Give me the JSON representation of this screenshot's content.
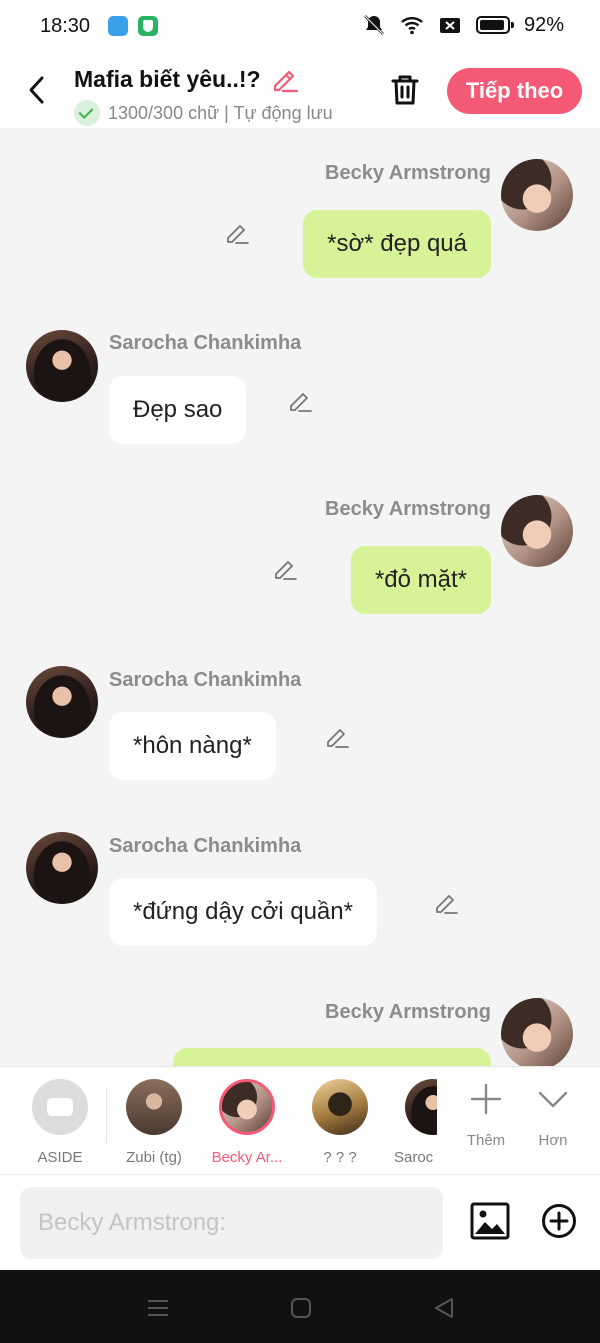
{
  "status_bar": {
    "time": "18:30",
    "battery": "92%"
  },
  "header": {
    "title": "Mafia biết yêu..!?",
    "meta": "1300/300 chữ | Tự động lưu",
    "next_label": "Tiếp theo"
  },
  "messages": [
    {
      "sender": "Becky Armstrong",
      "text": "*sờ* đẹp quá",
      "side": "right"
    },
    {
      "sender": "Sarocha Chankimha",
      "text": "Đẹp sao",
      "side": "left"
    },
    {
      "sender": "Becky Armstrong",
      "text": "*đỏ mặt*",
      "side": "right"
    },
    {
      "sender": "Sarocha Chankimha",
      "text": "*hôn nàng*",
      "side": "left"
    },
    {
      "sender": "Sarocha Chankimha",
      "text": "*đứng dậy cởi quần*",
      "side": "left"
    },
    {
      "sender": "Becky Armstrong",
      "text": "",
      "side": "right"
    }
  ],
  "characters": [
    {
      "label": "ASIDE"
    },
    {
      "label": "Zubi (tg)"
    },
    {
      "label": "Becky Ar..."
    },
    {
      "label": "? ? ?"
    },
    {
      "label": "Saroc"
    }
  ],
  "more": {
    "add_label": "Thêm",
    "more_label": "Hơn"
  },
  "composer": {
    "placeholder": "Becky Armstrong:"
  },
  "colors": {
    "accent": "#f45a75",
    "self_bubble": "#d6f497",
    "other_bubble": "#ffffff"
  }
}
